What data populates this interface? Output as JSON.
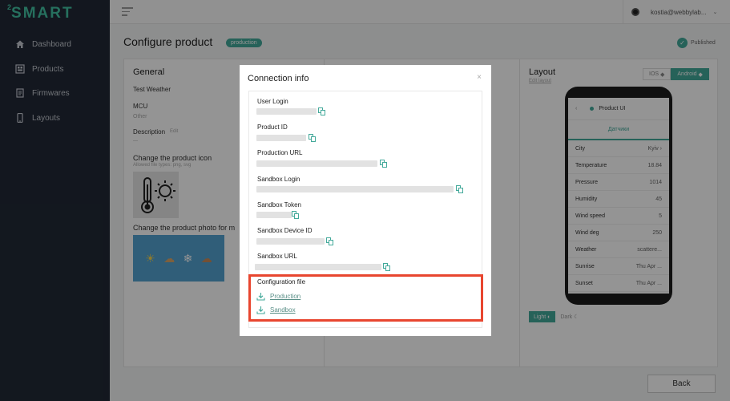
{
  "app": {
    "logo_sup": "2",
    "logo": "SMART"
  },
  "sidebar": {
    "items": [
      {
        "label": "Dashboard",
        "icon": "home-icon"
      },
      {
        "label": "Products",
        "icon": "products-icon"
      },
      {
        "label": "Firmwares",
        "icon": "firmware-icon"
      },
      {
        "label": "Layouts",
        "icon": "phone-icon"
      }
    ]
  },
  "topbar": {
    "user_email": "kostia@webbylab...",
    "chevron": "⌄"
  },
  "page": {
    "title": "Configure product",
    "env_badge": "production",
    "status": "Published",
    "back_label": "Back"
  },
  "general": {
    "title": "General",
    "product_name": "Test Weather",
    "mcu_label": "MCU",
    "mcu_value": "Other",
    "description_label": "Description",
    "description_edit": "Edit",
    "description_value": "—",
    "icon_title": "Change the product icon",
    "icon_hint": "Allowed file types: png, svg",
    "photo_title": "Change the product photo for m"
  },
  "layout": {
    "title": "Layout",
    "edit_link": "Edit layout",
    "os_options": [
      "IOS",
      "Android"
    ],
    "os_selected": "Android",
    "theme_options": [
      "Light",
      "Dark"
    ],
    "theme_selected": "Light",
    "phone": {
      "title": "Product UI",
      "tab": "Датчики",
      "rows": [
        {
          "label": "City",
          "value": "Kyiv"
        },
        {
          "label": "Temperature",
          "value": "18.84"
        },
        {
          "label": "Pressure",
          "value": "1014"
        },
        {
          "label": "Humidity",
          "value": "45"
        },
        {
          "label": "Wind speed",
          "value": "5"
        },
        {
          "label": "Wind deg",
          "value": "250"
        },
        {
          "label": "Weather",
          "value": "scattere..."
        },
        {
          "label": "Sunrise",
          "value": "Thu Apr ..."
        },
        {
          "label": "Sunset",
          "value": "Thu Apr ..."
        }
      ]
    }
  },
  "modal": {
    "title": "Connection info",
    "close": "×",
    "fields": [
      {
        "label": "User Login"
      },
      {
        "label": "Product ID"
      },
      {
        "label": "Production URL"
      },
      {
        "label": "Sandbox Login"
      },
      {
        "label": "Sandbox Token"
      },
      {
        "label": "Sandbox Device ID"
      },
      {
        "label": "Sandbox URL"
      }
    ],
    "config_title": "Configuration file",
    "downloads": [
      {
        "label": "Production",
        "icon": "download-icon"
      },
      {
        "label": "Sandbox",
        "icon": "download-icon"
      }
    ]
  },
  "colors": {
    "accent": "#43a99a",
    "sidebar_bg": "#212936",
    "logo": "#43c1a3",
    "highlight": "#e8462f"
  }
}
